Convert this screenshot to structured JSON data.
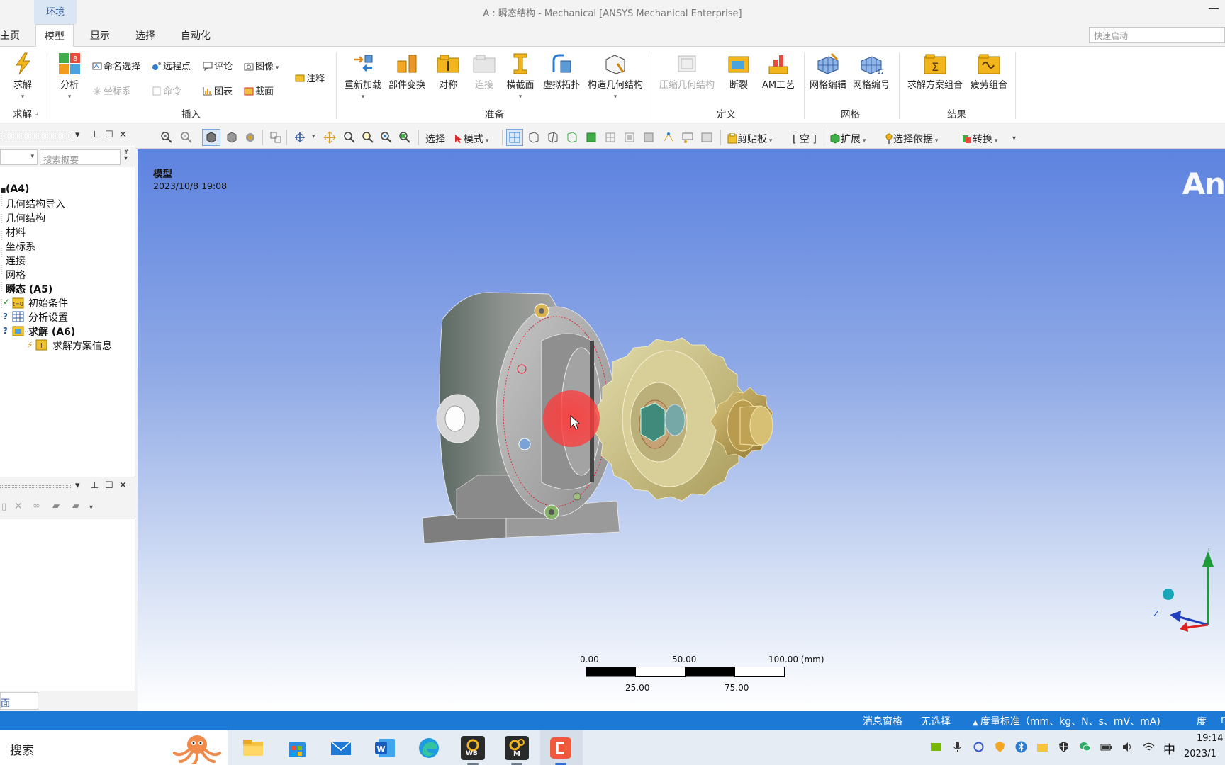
{
  "titlebar": {
    "context_tab": "环境",
    "title": "A : 瞬态结构 - Mechanical [ANSYS Mechanical Enterprise]",
    "minimize": "—"
  },
  "menu": {
    "tabs": [
      "主页",
      "模型",
      "显示",
      "选择",
      "自动化"
    ],
    "active": "模型",
    "quick_launch_placeholder": "快速启动"
  },
  "ribbon": {
    "solve": {
      "label": "求解",
      "group": "求解"
    },
    "analysis": {
      "label": "分析"
    },
    "insert": {
      "named_selection": "命名选择",
      "remote_point": "远程点",
      "comment": "评论",
      "image": "图像",
      "coordinate_system": "坐标系",
      "command": "命令",
      "chart": "图表",
      "section": "截面",
      "annotation": "注释",
      "group": "插入"
    },
    "prepare": {
      "items": [
        "重新加载",
        "部件变换",
        "对称",
        "连接",
        "横截面",
        "虚拟拓扑",
        "构造几何结构"
      ],
      "group": "准备"
    },
    "define": {
      "items": [
        "压缩几何结构",
        "断裂",
        "AM工艺"
      ],
      "group": "定义"
    },
    "mesh": {
      "items": [
        "网格编辑",
        "网格编号"
      ],
      "group": "网格"
    },
    "results": {
      "items": [
        "求解方案组合",
        "疲劳组合"
      ],
      "group": "结果"
    }
  },
  "toolbar": {
    "select": "选择",
    "mode": "模式",
    "clipboard": "剪贴板",
    "empty": "[ 空 ]",
    "extend": "扩展",
    "select_by": "选择依据",
    "convert": "转换"
  },
  "outline": {
    "search_placeholder": "搜索概要",
    "items": [
      {
        "label": "(A4)",
        "bold": true
      },
      {
        "label": "几何结构导入",
        "bold": false
      },
      {
        "label": "几何结构",
        "bold": false
      },
      {
        "label": "材料",
        "bold": false
      },
      {
        "label": "坐标系",
        "bold": false
      },
      {
        "label": "连接",
        "bold": false
      },
      {
        "label": "网格",
        "bold": false
      },
      {
        "label": "瞬态 (A5)",
        "bold": true
      },
      {
        "label": "初始条件",
        "bold": false
      },
      {
        "label": "分析设置",
        "bold": false
      },
      {
        "label": "求解 (A6)",
        "bold": true
      },
      {
        "label": "求解方案信息",
        "bold": false
      }
    ]
  },
  "details": {
    "tab": "面"
  },
  "viewport": {
    "title": "模型",
    "date": "2023/10/8 19:08",
    "logo": "An",
    "scale": {
      "top_labels": [
        "0.00",
        "50.00",
        "100.00 (mm)"
      ],
      "bottom_labels": [
        "25.00",
        "75.00"
      ]
    },
    "triad": {
      "y": "Y",
      "z": "Z"
    }
  },
  "statusbar": {
    "messages": "消息窗格",
    "selection": "无选择",
    "units": "度量标准（mm、kg、N、s、mV、mA)",
    "angle": "度",
    "extra": "r"
  },
  "taskbar": {
    "search": "搜索",
    "apps": [
      "file-explorer",
      "store",
      "mail",
      "word",
      "edge",
      "workbench",
      "mechanical",
      "recorder"
    ],
    "wb_label": "WB",
    "mech_label": "M",
    "ime": "中",
    "time": "19:14",
    "date": "2023/1"
  },
  "colors": {
    "accent": "#1c7ad6",
    "viewport_top": "#5d83e0",
    "viewport_bottom": "#ffffff",
    "context_tab": "#dbe6f4"
  }
}
